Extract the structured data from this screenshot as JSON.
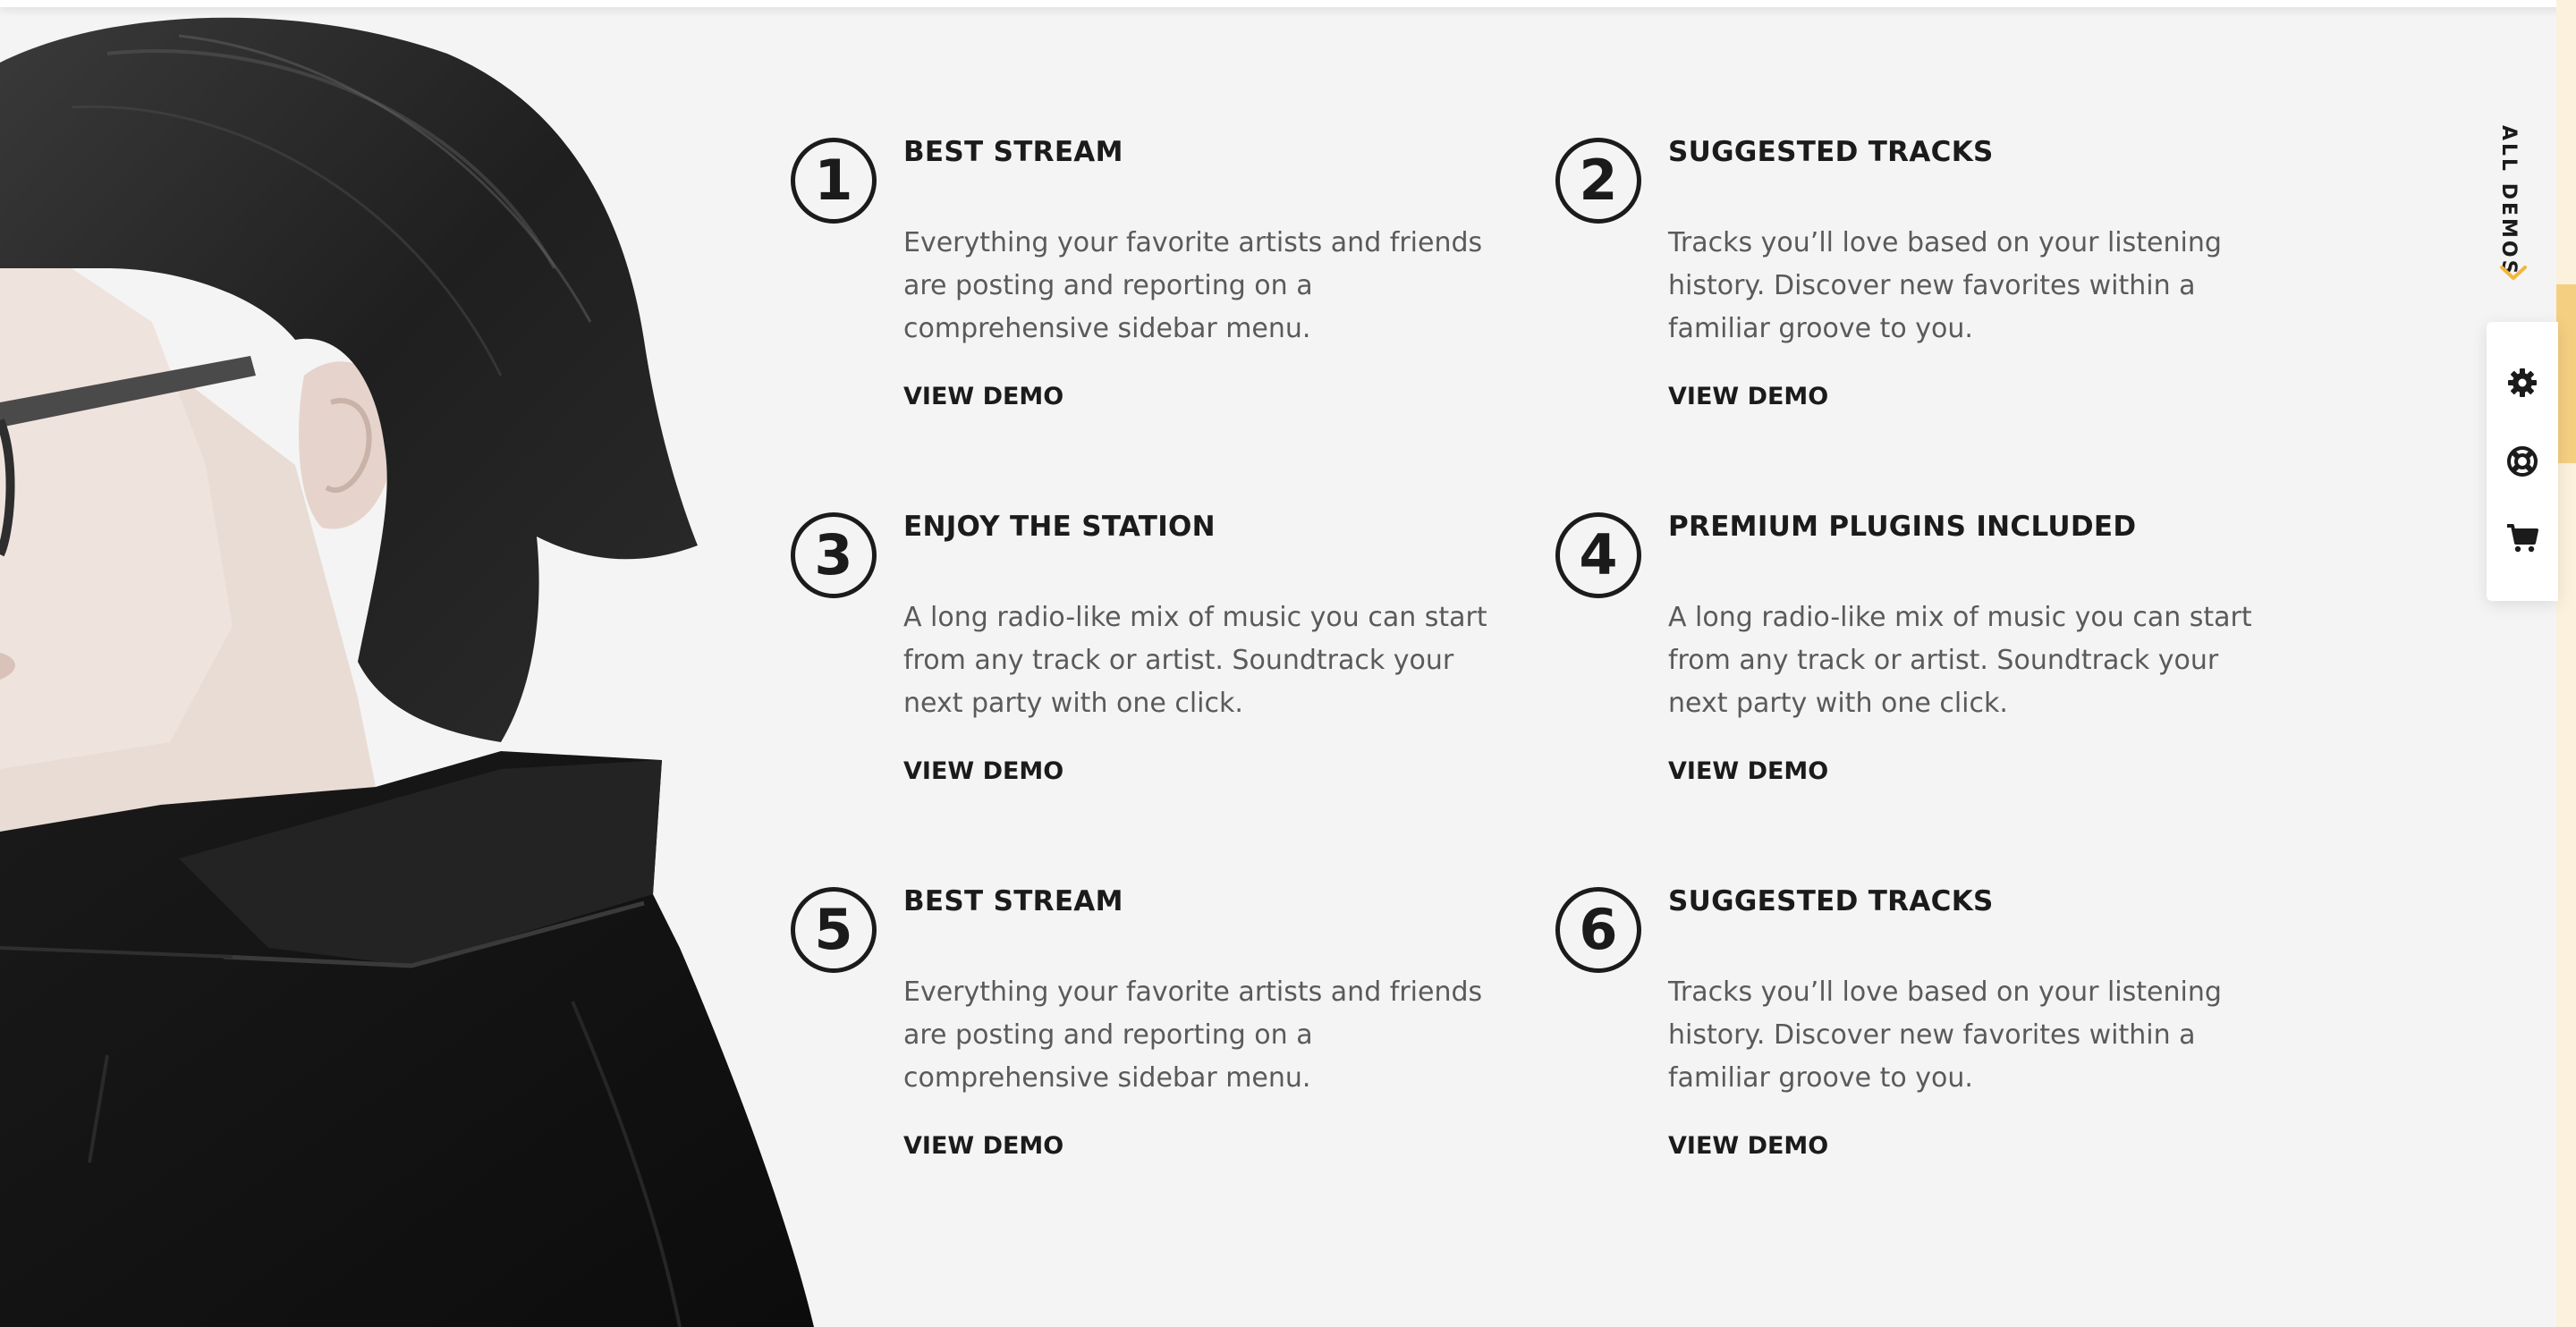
{
  "features": [
    {
      "number": "1",
      "title": "BEST STREAM",
      "description": "Everything your favorite artists and friends are posting and reporting on a comprehensive sidebar menu.",
      "link": "VIEW DEMO"
    },
    {
      "number": "2",
      "title": "SUGGESTED TRACKS",
      "description": "Tracks you’ll love based on your listening history. Discover new favorites within a familiar groove to you.",
      "link": "VIEW DEMO"
    },
    {
      "number": "3",
      "title": "ENJOY THE STATION",
      "description": "A long radio-like mix of music you can start from any track or artist. Soundtrack your next party with one click.",
      "link": "VIEW DEMO"
    },
    {
      "number": "4",
      "title": "PREMIUM PLUGINS INCLUDED",
      "description": "A long radio-like mix of music you can start from any track or artist. Soundtrack your next party with one click.",
      "link": "VIEW DEMO"
    },
    {
      "number": "5",
      "title": "BEST STREAM",
      "description": "Everything your favorite artists and friends are posting and reporting on a comprehensive sidebar menu.",
      "link": "VIEW DEMO"
    },
    {
      "number": "6",
      "title": "SUGGESTED TRACKS",
      "description": "Tracks you’ll love based on your listening history. Discover new favorites within a familiar groove to you.",
      "link": "VIEW DEMO"
    }
  ],
  "side_panel": {
    "all_demos_label": "ALL DEMOS",
    "icons": [
      "gear-icon",
      "lifebuoy-icon",
      "cart-icon"
    ]
  },
  "colors": {
    "background": "#f4f4f4",
    "text_dark": "#1b1b1b",
    "text_body": "#5a5a5a",
    "accent": "#f4b63c"
  }
}
